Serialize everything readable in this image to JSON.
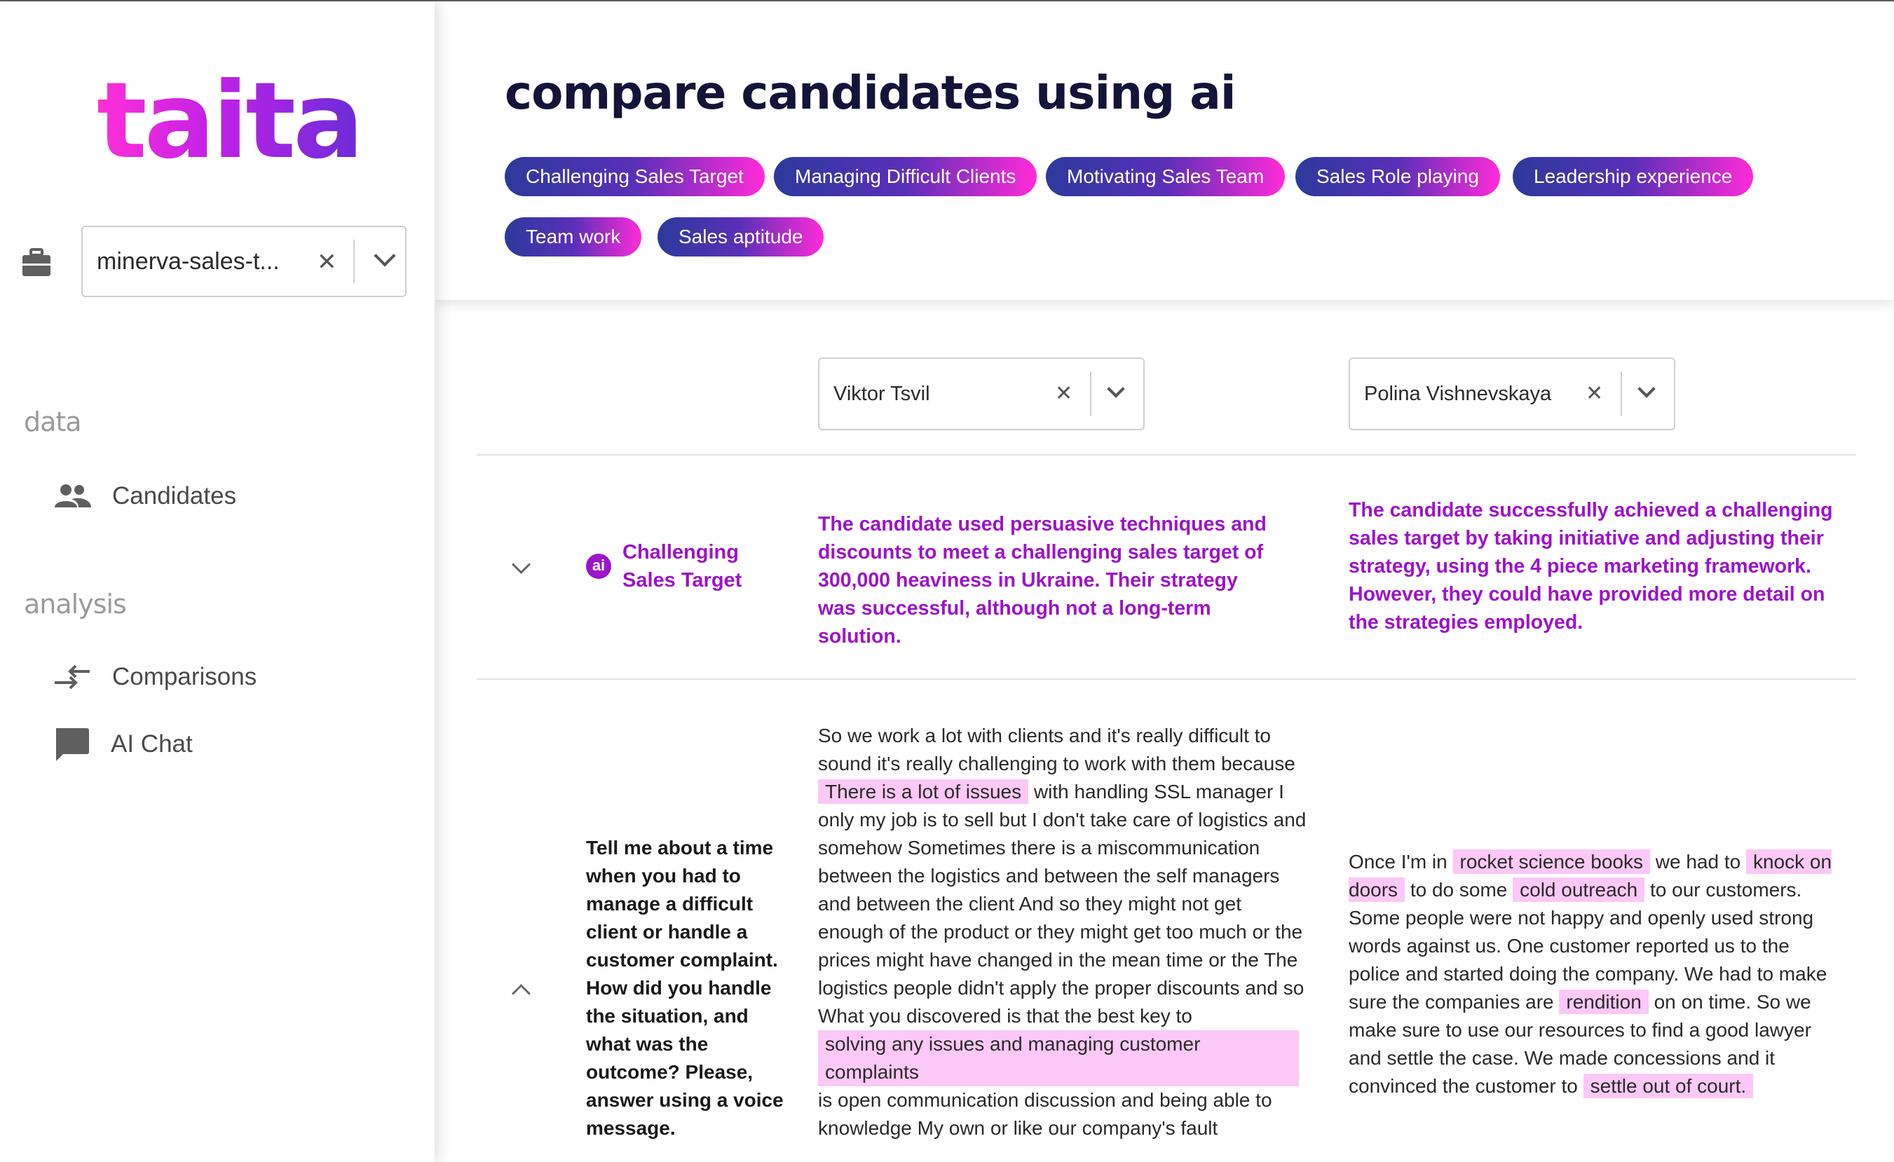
{
  "app": {
    "logo_text": "taita"
  },
  "sidebar": {
    "project_select": {
      "value": "minerva-sales-t...",
      "clear": "✕"
    },
    "sections": [
      {
        "label": "data",
        "items": [
          {
            "label": "Candidates",
            "icon": "people-icon"
          }
        ]
      },
      {
        "label": "analysis",
        "items": [
          {
            "label": "Comparisons",
            "icon": "compare-arrows-icon"
          },
          {
            "label": "AI Chat",
            "icon": "chat-icon"
          }
        ]
      }
    ]
  },
  "header": {
    "title": "compare candidates using ai",
    "chips": [
      "Challenging Sales Target",
      "Managing Difficult Clients",
      "Motivating Sales Team",
      "Sales Role playing",
      "Leadership experience",
      "Team work",
      "Sales aptitude"
    ]
  },
  "comparison": {
    "candidates": [
      {
        "name": "Viktor Tsvil",
        "clear": "✕"
      },
      {
        "name": "Polina Vishnevskaya",
        "clear": "✕"
      }
    ],
    "rows": [
      {
        "ai_badge": "ai",
        "topic": "Challenging Sales Target",
        "summaries": [
          "The candidate used persuasive techniques and discounts to meet a challenging sales target of 300,000 heaviness in Ukraine. Their strategy was successful, although not a long-term solution.",
          "The candidate successfully achieved a challenging sales target by taking initiative and adjusting their strategy, using the 4 piece marketing framework. However, they could have provided more detail on the strategies employed."
        ]
      },
      {
        "question": "Tell me about a time when you had to manage a difficult client or handle a customer complaint. How did you handle the situation, and what was the outcome? Please, answer using a voice message.",
        "answer1": {
          "p1": "So we work a lot with clients and it's really difficult to sound it's really challenging to work with them because ",
          "h1": "There is a lot of issues",
          "p2": " with handling SSL manager I only my job is to sell but I don't take care of logistics and somehow Sometimes there is a miscommunication between the logistics and between the self managers and between the client And so they might not get enough of the product or they might get too much or the prices might have changed in the mean time or the The logistics people didn't apply the proper discounts and so What you discovered is that the best key to",
          "h2": "solving any issues and managing customer complaints",
          "p3": "is open communication discussion and being able to knowledge My own or like our company's fault"
        },
        "answer2": {
          "p1": "Once I'm in ",
          "h1": "rocket science books",
          "p2": " we had to ",
          "h2": "knock on doors",
          "p3": " to do some ",
          "h3": "cold outreach",
          "p4": " to our customers. Some people were not happy and openly used strong words against us. One customer reported us to the police and started doing the company. We had to make sure the companies are ",
          "h4": "rendition",
          "p5": " on on time. So we make sure to use our resources to find a good lawyer and settle the case. We made concessions and it convinced the customer to ",
          "h5": "settle out of court."
        }
      }
    ]
  }
}
